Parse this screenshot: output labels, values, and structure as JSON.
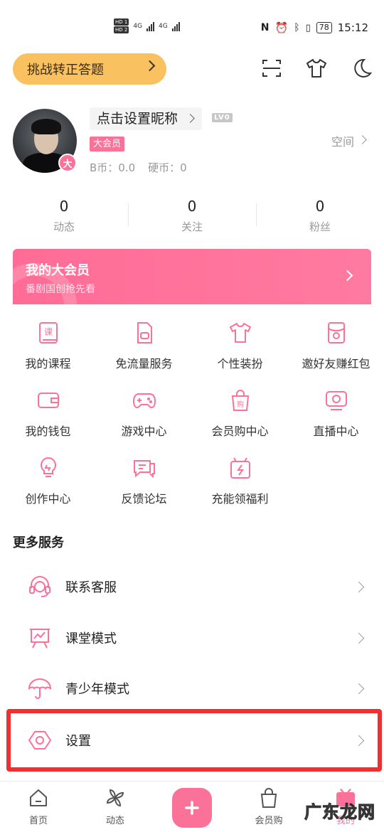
{
  "status_bar": {
    "sim1": "HD 1",
    "sim2": "HD 2",
    "net1": "4G",
    "net2": "4G",
    "battery": "78",
    "time": "15:12"
  },
  "header": {
    "challenge_label": "挑战转正答题"
  },
  "profile": {
    "nickname_prompt": "点击设置昵称",
    "level": "LV0",
    "vip_tag": "大会员",
    "vip_badge": "大",
    "b_coin": "B币：0.0",
    "hard_coin": "硬币：0",
    "space_label": "空间"
  },
  "stats": [
    {
      "value": "0",
      "label": "动态"
    },
    {
      "value": "0",
      "label": "关注"
    },
    {
      "value": "0",
      "label": "粉丝"
    }
  ],
  "vip_banner": {
    "title": "我的大会员",
    "subtitle": "番剧国创抢先看"
  },
  "grid": [
    {
      "label": "我的课程",
      "icon": "course-icon"
    },
    {
      "label": "免流量服务",
      "icon": "sim-card-icon"
    },
    {
      "label": "个性装扮",
      "icon": "tshirt-icon"
    },
    {
      "label": "邀好友赚红包",
      "icon": "red-packet-icon"
    },
    {
      "label": "我的钱包",
      "icon": "wallet-icon"
    },
    {
      "label": "游戏中心",
      "icon": "gamepad-icon"
    },
    {
      "label": "会员购中心",
      "icon": "shopping-bag-icon"
    },
    {
      "label": "直播中心",
      "icon": "live-tv-icon"
    },
    {
      "label": "创作中心",
      "icon": "lightbulb-icon"
    },
    {
      "label": "反馈论坛",
      "icon": "chat-bubbles-icon"
    },
    {
      "label": "充能领福利",
      "icon": "gift-box-icon"
    }
  ],
  "more_services": {
    "title": "更多服务",
    "items": [
      {
        "label": "联系客服",
        "icon": "headset-icon"
      },
      {
        "label": "课堂模式",
        "icon": "classroom-icon"
      },
      {
        "label": "青少年模式",
        "icon": "umbrella-icon"
      },
      {
        "label": "设置",
        "icon": "settings-hexagon-icon"
      }
    ]
  },
  "tabbar": [
    {
      "label": "首页",
      "icon": "home-icon"
    },
    {
      "label": "动态",
      "icon": "pinwheel-icon"
    },
    {
      "label": "会员购",
      "icon": "shopping-bag-icon"
    },
    {
      "label": "我的",
      "icon": "tv-mascot-icon"
    }
  ],
  "watermark": "广东龙网",
  "colors": {
    "brand_pink": "#fb7299",
    "challenge_yellow": "#f9c160",
    "highlight_red": "#ee3030"
  }
}
